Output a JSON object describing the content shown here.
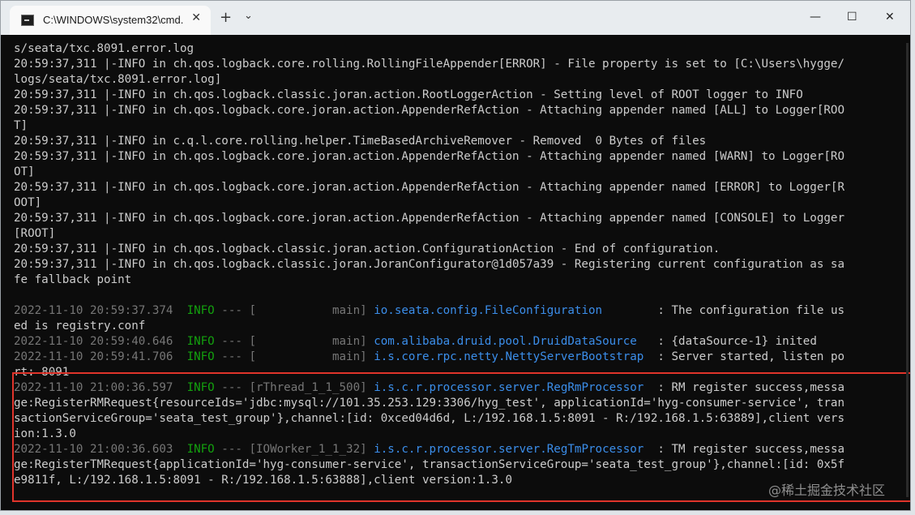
{
  "window": {
    "tab_title": "C:\\WINDOWS\\system32\\cmd.",
    "close_tab_glyph": "✕",
    "new_tab_glyph": "+",
    "dropdown_glyph": "⌄",
    "minimize_glyph": "—",
    "maximize_glyph": "☐",
    "close_glyph": "✕",
    "icon": "cmd-icon"
  },
  "terminal": {
    "plain_lines": [
      "s/seata/txc.8091.error.log",
      "20:59:37,311 |-INFO in ch.qos.logback.core.rolling.RollingFileAppender[ERROR] - File property is set to [C:\\Users\\hygge/",
      "logs/seata/txc.8091.error.log]",
      "20:59:37,311 |-INFO in ch.qos.logback.classic.joran.action.RootLoggerAction - Setting level of ROOT logger to INFO",
      "20:59:37,311 |-INFO in ch.qos.logback.core.joran.action.AppenderRefAction - Attaching appender named [ALL] to Logger[ROO",
      "T]",
      "20:59:37,311 |-INFO in c.q.l.core.rolling.helper.TimeBasedArchiveRemover - Removed  0 Bytes of files",
      "20:59:37,311 |-INFO in ch.qos.logback.core.joran.action.AppenderRefAction - Attaching appender named [WARN] to Logger[RO",
      "OT]",
      "20:59:37,311 |-INFO in ch.qos.logback.core.joran.action.AppenderRefAction - Attaching appender named [ERROR] to Logger[R",
      "OOT]",
      "20:59:37,311 |-INFO in ch.qos.logback.core.joran.action.AppenderRefAction - Attaching appender named [CONSOLE] to Logger",
      "[ROOT]",
      "20:59:37,311 |-INFO in ch.qos.logback.classic.joran.action.ConfigurationAction - End of configuration.",
      "20:59:37,311 |-INFO in ch.qos.logback.classic.joran.JoranConfigurator@1d057a39 - Registering current configuration as sa",
      "fe fallback point"
    ],
    "log_entries": [
      {
        "ts": "2022-11-10 20:59:37.374",
        "level": "INFO",
        "dash": "---",
        "thread": "[           main]",
        "cls": "io.seata.config.FileConfiguration",
        "msg": "        : The configuration file us",
        "cont": [
          "ed is registry.conf"
        ]
      },
      {
        "ts": "2022-11-10 20:59:40.646",
        "level": "INFO",
        "dash": "---",
        "thread": "[           main]",
        "cls": "com.alibaba.druid.pool.DruidDataSource",
        "msg": "   : {dataSource-1} inited",
        "cont": []
      },
      {
        "ts": "2022-11-10 20:59:41.706",
        "level": "INFO",
        "dash": "---",
        "thread": "[           main]",
        "cls": "i.s.core.rpc.netty.NettyServerBootstrap",
        "msg": "  : Server started, listen po",
        "cont": [
          "rt: 8091"
        ]
      },
      {
        "ts": "2022-11-10 21:00:36.597",
        "level": "INFO",
        "dash": "---",
        "thread": "[rThread_1_1_500]",
        "cls": "i.s.c.r.processor.server.RegRmProcessor",
        "msg": "  : RM register success,messa",
        "cont": [
          "ge:RegisterRMRequest{resourceIds='jdbc:mysql://101.35.253.129:3306/hyg_test', applicationId='hyg-consumer-service', tran",
          "sactionServiceGroup='seata_test_group'},channel:[id: 0xced04d6d, L:/192.168.1.5:8091 - R:/192.168.1.5:63889],client vers",
          "ion:1.3.0"
        ]
      },
      {
        "ts": "2022-11-10 21:00:36.603",
        "level": "INFO",
        "dash": "---",
        "thread": "[IOWorker_1_1_32]",
        "cls": "i.s.c.r.processor.server.RegTmProcessor",
        "msg": "  : TM register success,messa",
        "cont": [
          "ge:RegisterTMRequest{applicationId='hyg-consumer-service', transactionServiceGroup='seata_test_group'},channel:[id: 0x5f",
          "e9811f, L:/192.168.1.5:8091 - R:/192.168.1.5:63888],client version:1.3.0"
        ]
      }
    ]
  },
  "watermark": "@稀土掘金技术社区",
  "colors": {
    "background": "#0c0c0c",
    "text": "#cccccc",
    "timestamp": "#767676",
    "info_level": "#13a10e",
    "logger_class": "#3b8eea",
    "highlight_border": "#e0342b"
  }
}
